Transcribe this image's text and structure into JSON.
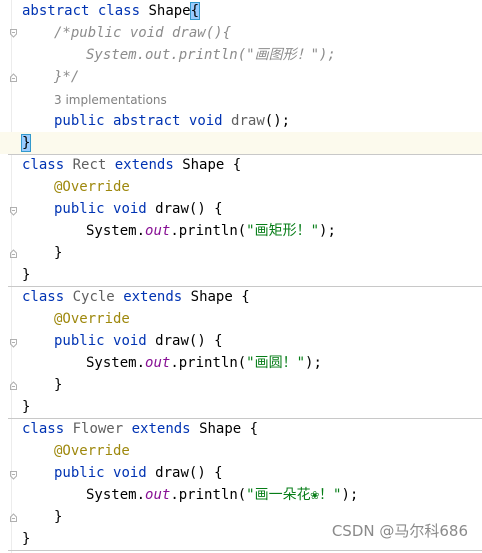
{
  "code": {
    "abstract_class": {
      "kw_abstract": "abstract",
      "kw_class": "class",
      "name": "Shape",
      "open_brace": "{",
      "comment_1": "/*public void draw(){",
      "comment_2": "System.out.println(\"画图形！\");",
      "comment_3": "}*/",
      "implementations_hint": "3 implementations",
      "method_kw_public": "public",
      "method_kw_abstract": "abstract",
      "method_kw_void": "void",
      "method_name": "draw",
      "method_tail": "();",
      "close_brace": "}"
    },
    "subclasses": [
      {
        "kw_class": "class",
        "name": "Rect",
        "kw_extends": "extends",
        "parent": "Shape",
        "open_brace": "{",
        "annotation": "@Override",
        "kw_public": "public",
        "kw_void": "void",
        "method_sig": "draw() {",
        "sys": "System.",
        "out": "out",
        "println": ".println(",
        "string": "\"画矩形！\"",
        "stmt_end": ");",
        "method_close": "}",
        "class_close": "}"
      },
      {
        "kw_class": "class",
        "name": "Cycle",
        "kw_extends": "extends",
        "parent": "Shape",
        "open_brace": "{",
        "annotation": "@Override",
        "kw_public": "public",
        "kw_void": "void",
        "method_sig": "draw() {",
        "sys": "System.",
        "out": "out",
        "println": ".println(",
        "string": "\"画圆！\"",
        "stmt_end": ");",
        "method_close": "}",
        "class_close": "}"
      },
      {
        "kw_class": "class",
        "name": "Flower",
        "kw_extends": "extends",
        "parent": "Shape",
        "open_brace": "{",
        "annotation": "@Override",
        "kw_public": "public",
        "kw_void": "void",
        "method_sig": "draw() {",
        "sys": "System.",
        "out": "out",
        "println": ".println(",
        "string": "\"画一朵花❀！\"",
        "stmt_end": ");",
        "method_close": "}",
        "class_close": "}"
      }
    ]
  },
  "watermark": "CSDN @马尔科686",
  "colors": {
    "keyword": "#0033b3",
    "annotation": "#9e880d",
    "static_field": "#871094",
    "string": "#067d17",
    "comment": "#8c8c8c",
    "brace_highlight": "#99ccff"
  }
}
